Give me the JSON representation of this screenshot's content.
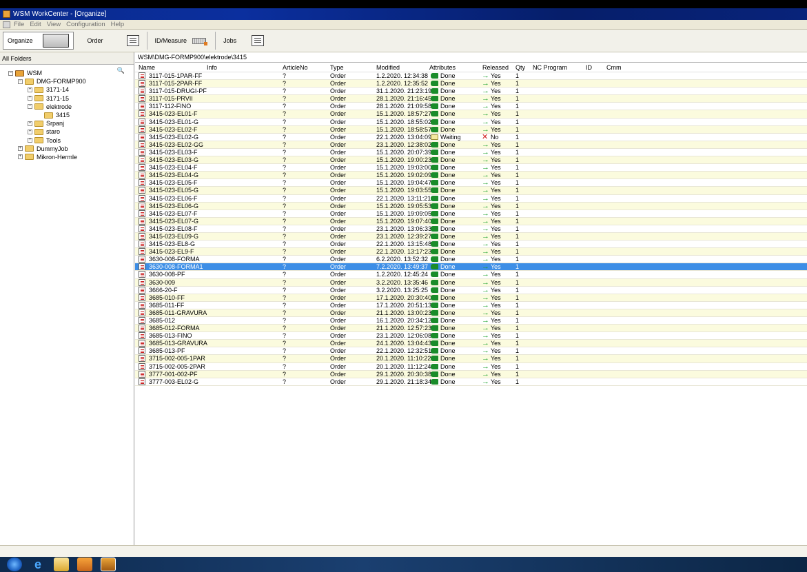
{
  "window": {
    "title": "WSM WorkCenter - [Organize]"
  },
  "menu": [
    "File",
    "Edit",
    "View",
    "Configuration",
    "Help"
  ],
  "toolbar": {
    "organize": "Organize",
    "order": "Order",
    "measure": "ID/Measure",
    "jobs": "Jobs"
  },
  "left": {
    "header": "All Folders",
    "tree": [
      {
        "label": "WSM",
        "depth": 0,
        "exp": "−"
      },
      {
        "label": "DMG-FORMP900",
        "depth": 1,
        "exp": "−"
      },
      {
        "label": "3171-14",
        "depth": 2,
        "exp": "+"
      },
      {
        "label": "3171-15",
        "depth": 2,
        "exp": "+"
      },
      {
        "label": "elektrode",
        "depth": 2,
        "exp": "−"
      },
      {
        "label": "3415",
        "depth": 3,
        "exp": ""
      },
      {
        "label": "Srpanj",
        "depth": 2,
        "exp": "+"
      },
      {
        "label": "staro",
        "depth": 2,
        "exp": "+"
      },
      {
        "label": "Tools",
        "depth": 2,
        "exp": "+"
      },
      {
        "label": "DummyJob",
        "depth": 1,
        "exp": "+"
      },
      {
        "label": "Mikron-Hermle",
        "depth": 1,
        "exp": "+"
      }
    ]
  },
  "right": {
    "path": "WSM\\DMG-FORMP900\\elektrode\\3415",
    "columns": {
      "name": "Name",
      "info": "Info",
      "article": "ArticleNo",
      "type": "Type",
      "modified": "Modified",
      "attributes": "Attributes",
      "released": "Released",
      "qty": "Qty",
      "nc": "NC Program",
      "id": "ID",
      "cmm": "Cmm"
    },
    "rows": [
      [
        "3117-015-1PAR-FF",
        "1.2.2020. 12:34:38",
        "Done",
        "Yes"
      ],
      [
        "3117-015-2PAR-FF",
        "1.2.2020. 12:35:52",
        "Done",
        "Yes"
      ],
      [
        "3117-015-DRUGI-PF",
        "31.1.2020. 21:23:19",
        "Done",
        "Yes"
      ],
      [
        "3117-015-PRVII",
        "28.1.2020. 21:16:45",
        "Done",
        "Yes"
      ],
      [
        "3117-112-FINO",
        "28.1.2020. 21:09:58",
        "Done",
        "Yes"
      ],
      [
        "3415-023-EL01-F",
        "15.1.2020. 18:57:27",
        "Done",
        "Yes"
      ],
      [
        "3415-023-EL01-G",
        "15.1.2020. 18:55:02",
        "Done",
        "Yes"
      ],
      [
        "3415-023-EL02-F",
        "15.1.2020. 18:58:57",
        "Done",
        "Yes"
      ],
      [
        "3415-023-EL02-G",
        "22.1.2020. 13:04:09",
        "Waiting",
        "No"
      ],
      [
        "3415-023-EL02-GG",
        "23.1.2020. 12:38:02",
        "Done",
        "Yes"
      ],
      [
        "3415-023-EL03-F",
        "15.1.2020. 20:07:39",
        "Done",
        "Yes"
      ],
      [
        "3415-023-EL03-G",
        "15.1.2020. 19:00:23",
        "Done",
        "Yes"
      ],
      [
        "3415-023-EL04-F",
        "15.1.2020. 19:03:00",
        "Done",
        "Yes"
      ],
      [
        "3415-023-EL04-G",
        "15.1.2020. 19:02:09",
        "Done",
        "Yes"
      ],
      [
        "3415-023-EL05-F",
        "15.1.2020. 19:04:47",
        "Done",
        "Yes"
      ],
      [
        "3415-023-EL05-G",
        "15.1.2020. 19:03:55",
        "Done",
        "Yes"
      ],
      [
        "3415-023-EL06-F",
        "22.1.2020. 13:11:21",
        "Done",
        "Yes"
      ],
      [
        "3415-023-EL06-G",
        "15.1.2020. 19:05:53",
        "Done",
        "Yes"
      ],
      [
        "3415-023-EL07-F",
        "15.1.2020. 19:09:05",
        "Done",
        "Yes"
      ],
      [
        "3415-023-EL07-G",
        "15.1.2020. 19:07:40",
        "Done",
        "Yes"
      ],
      [
        "3415-023-EL08-F",
        "23.1.2020. 13:06:33",
        "Done",
        "Yes"
      ],
      [
        "3415-023-EL09-G",
        "23.1.2020. 12:39:27",
        "Done",
        "Yes"
      ],
      [
        "3415-023-EL8-G",
        "22.1.2020. 13:15:48",
        "Done",
        "Yes"
      ],
      [
        "3415-023-EL9-F",
        "22.1.2020. 13:17:23",
        "Done",
        "Yes"
      ],
      [
        "3630-008-FORMA",
        "6.2.2020. 13:52:32",
        "Done",
        "Yes"
      ],
      [
        "3630-008-FORMA1",
        "7.2.2020. 13:49:37",
        "Done",
        "Yes"
      ],
      [
        "3630-008-PF",
        "1.2.2020. 12:45:24",
        "Done",
        "Yes"
      ],
      [
        "3630-009",
        "3.2.2020. 13:35:46",
        "Done",
        "Yes"
      ],
      [
        "3666-20-F",
        "3.2.2020. 13:25:25",
        "Done",
        "Yes"
      ],
      [
        "3685-010-FF",
        "17.1.2020. 20:30:40",
        "Done",
        "Yes"
      ],
      [
        "3685-011-FF",
        "17.1.2020. 20:51:13",
        "Done",
        "Yes"
      ],
      [
        "3685-011-GRAVURA",
        "21.1.2020. 13:00:23",
        "Done",
        "Yes"
      ],
      [
        "3685-012",
        "16.1.2020. 20:34:12",
        "Done",
        "Yes"
      ],
      [
        "3685-012-FORMA",
        "21.1.2020. 12:57:23",
        "Done",
        "Yes"
      ],
      [
        "3685-013-FINO",
        "23.1.2020. 12:06:08",
        "Done",
        "Yes"
      ],
      [
        "3685-013-GRAVURA",
        "24.1.2020. 13:04:43",
        "Done",
        "Yes"
      ],
      [
        "3685-013-PF",
        "22.1.2020. 12:32:51",
        "Done",
        "Yes"
      ],
      [
        "3715-002-005-1PAR",
        "20.1.2020. 11:10:22",
        "Done",
        "Yes"
      ],
      [
        "3715-002-005-2PAR",
        "20.1.2020. 11:12:24",
        "Done",
        "Yes"
      ],
      [
        "3777-001-002-PF",
        "29.1.2020. 20:30:38",
        "Done",
        "Yes"
      ],
      [
        "3777-003-EL02-G",
        "29.1.2020. 21:18:34",
        "Done",
        "Yes"
      ]
    ],
    "article_value": "?",
    "type_value": "Order",
    "qty_value": "1",
    "selected_row": 25
  },
  "colors": {
    "selection": "#3d8ee6",
    "alt_row": "#fbfbde",
    "done": "#1a8c2a"
  }
}
